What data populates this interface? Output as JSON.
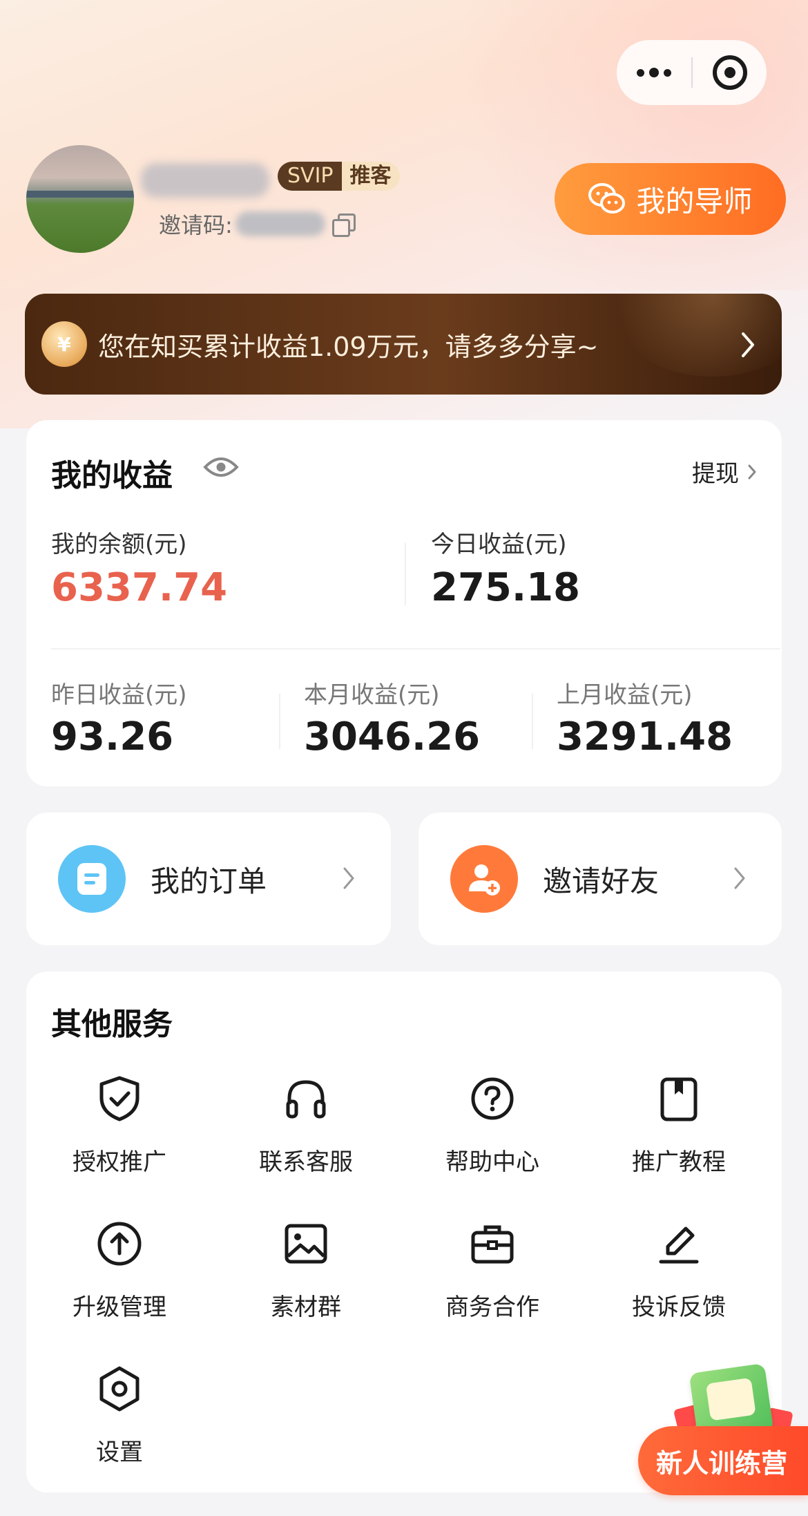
{
  "header": {
    "user_badge_svip": "SVIP",
    "user_badge_role": "推客",
    "invite_code_label": "邀请码:",
    "mentor_button": "我的导师"
  },
  "banner": {
    "text": "您在知买累计收益1.09万元，请多多分享~",
    "coin_symbol": "¥"
  },
  "earnings": {
    "title": "我的收益",
    "withdraw_label": "提现",
    "balance_label": "我的余额(元)",
    "balance_value": "6337.74",
    "today_label": "今日收益(元)",
    "today_value": "275.18",
    "yesterday_label": "昨日收益(元)",
    "yesterday_value": "93.26",
    "this_month_label": "本月收益(元)",
    "this_month_value": "3046.26",
    "last_month_label": "上月收益(元)",
    "last_month_value": "3291.48"
  },
  "quick_links": [
    {
      "label": "我的订单",
      "icon": "order-icon",
      "color": "#5ec4f5"
    },
    {
      "label": "邀请好友",
      "icon": "add-user-icon",
      "color": "#ff7a3a"
    }
  ],
  "services": {
    "title": "其他服务",
    "items": [
      {
        "label": "授权推广",
        "icon": "shield-check-icon"
      },
      {
        "label": "联系客服",
        "icon": "headphones-icon"
      },
      {
        "label": "帮助中心",
        "icon": "help-circle-icon"
      },
      {
        "label": "推广教程",
        "icon": "bookmark-icon"
      },
      {
        "label": "升级管理",
        "icon": "upgrade-arrow-icon"
      },
      {
        "label": "素材群",
        "icon": "image-icon"
      },
      {
        "label": "商务合作",
        "icon": "briefcase-icon"
      },
      {
        "label": "投诉反馈",
        "icon": "pencil-icon"
      },
      {
        "label": "设置",
        "icon": "settings-hex-icon"
      }
    ]
  },
  "promo": {
    "label": "新人训练营"
  },
  "colors": {
    "accent_orange": "#ff6d22",
    "balance_red": "#e8624e",
    "banner_brown": "#4b2810"
  }
}
